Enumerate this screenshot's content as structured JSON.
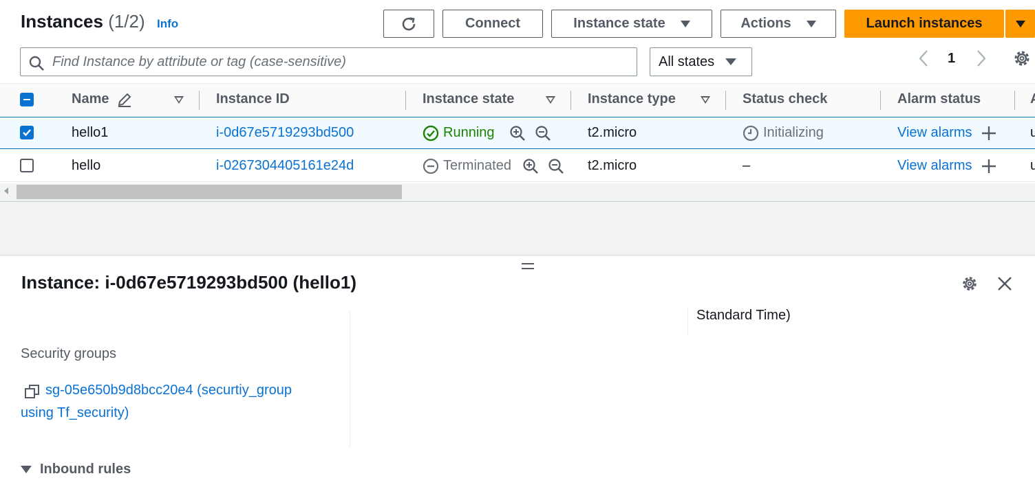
{
  "header": {
    "title": "Instances",
    "count": "(1/2)",
    "info": "Info",
    "connect": "Connect",
    "instance_state": "Instance state",
    "actions": "Actions",
    "launch": "Launch instances"
  },
  "filter": {
    "placeholder": "Find Instance by attribute or tag (case-sensitive)",
    "state_select": "All states",
    "page": "1"
  },
  "table": {
    "columns": [
      "Name",
      "Instance ID",
      "Instance state",
      "Instance type",
      "Status check",
      "Alarm status",
      "A"
    ],
    "rows": [
      {
        "selected": true,
        "name": "hello1",
        "id": "i-0d67e5719293bd500",
        "state": "Running",
        "type": "t2.micro",
        "status": "Initializing",
        "alarm": "View alarms",
        "extra": "u"
      },
      {
        "selected": false,
        "name": "hello",
        "id": "i-0267304405161e24d",
        "state": "Terminated",
        "type": "t2.micro",
        "status": "–",
        "alarm": "View alarms",
        "extra": "u"
      }
    ]
  },
  "details": {
    "title": "Instance: i-0d67e5719293bd500 (hello1)",
    "partial_text": "Standard Time)",
    "security_groups_label": "Security groups",
    "security_group_line1": "sg-05e650b9d8bcc20e4 (securtiy_group",
    "security_group_line2": "using Tf_security)",
    "inbound_rules": "Inbound rules"
  },
  "colors": {
    "primary_button": "#ff9900",
    "link": "#0972d3",
    "running": "#1d8102",
    "selected_row": "#f1faff"
  }
}
